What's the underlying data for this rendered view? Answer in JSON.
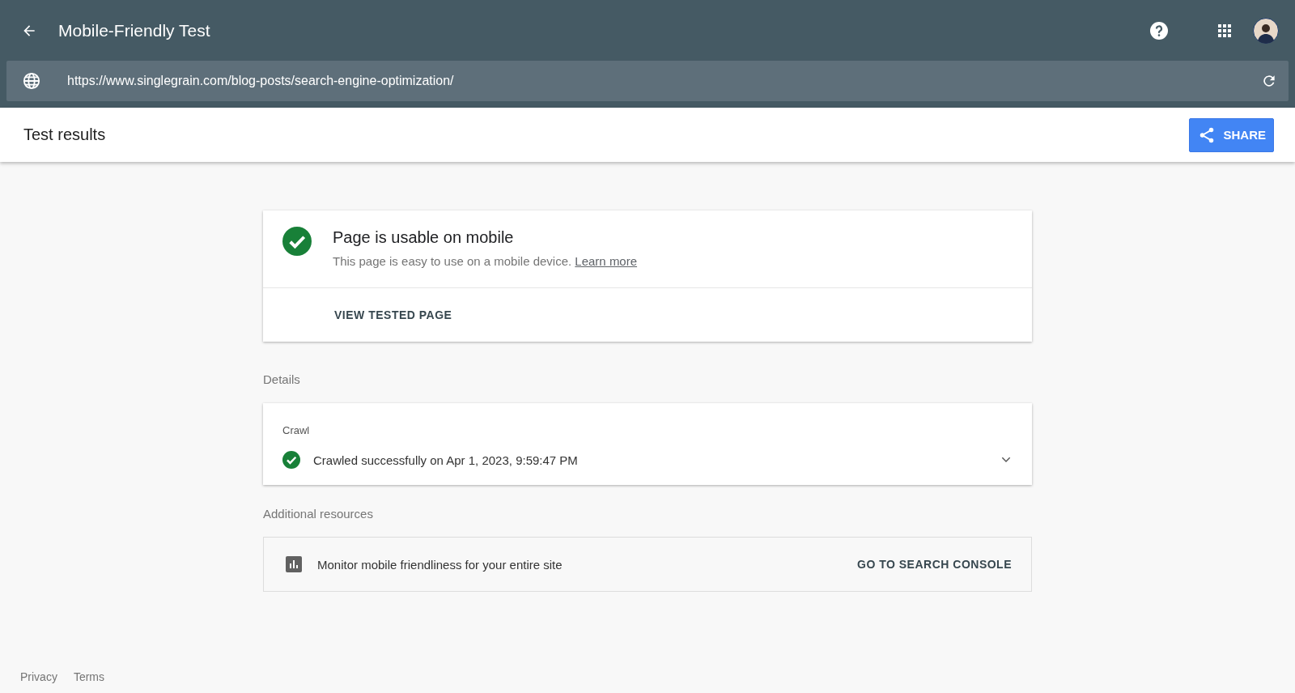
{
  "app_bar": {
    "title": "Mobile-Friendly Test"
  },
  "url_bar": {
    "value": "https://www.singlegrain.com/blog-posts/search-engine-optimization/"
  },
  "results_bar": {
    "title": "Test results",
    "share_button": "SHARE"
  },
  "verdict": {
    "title": "Page is usable on mobile",
    "description": "This page is easy to use on a mobile device.",
    "link": "Learn more",
    "action": "VIEW TESTED PAGE"
  },
  "details": {
    "heading": "Details",
    "section": "Crawl",
    "status": "Crawled successfully on Apr 1, 2023, 9:59:47 PM",
    "expanded": false
  },
  "resources": {
    "heading": "Additional resources",
    "text": "Monitor mobile friendliness for your entire site",
    "action": "GO TO SEARCH CONSOLE"
  },
  "footer": {
    "links": [
      "Privacy",
      "Terms"
    ]
  }
}
